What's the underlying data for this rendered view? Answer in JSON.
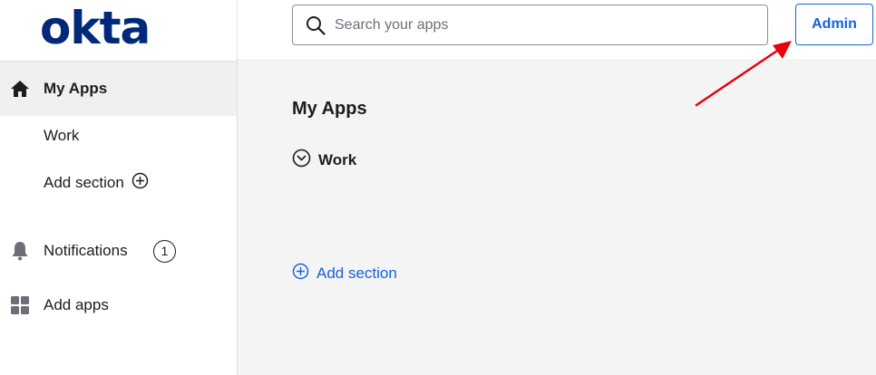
{
  "brand": {
    "logo_text": "okta",
    "logo_color": "#00297a",
    "accent": "#1662dd"
  },
  "header": {
    "search": {
      "placeholder": "Search your apps",
      "value": "",
      "icon": "search-icon"
    },
    "admin_label": "Admin"
  },
  "sidebar": {
    "items": [
      {
        "label": "My Apps",
        "icon": "home-icon",
        "active": true
      },
      {
        "label": "Work"
      },
      {
        "label": "Add section",
        "icon": "plus-circle-icon"
      },
      {
        "label": "Notifications",
        "icon": "bell-icon",
        "badge": "1"
      },
      {
        "label": "Add apps",
        "icon": "grid-icon"
      }
    ]
  },
  "main": {
    "title": "My Apps",
    "sections": [
      {
        "label": "Work",
        "icon": "chevron-down-circle-icon"
      }
    ],
    "add_section_label": "Add section"
  },
  "annotation": {
    "arrow_color": "#e8000b",
    "target": "admin-button"
  }
}
